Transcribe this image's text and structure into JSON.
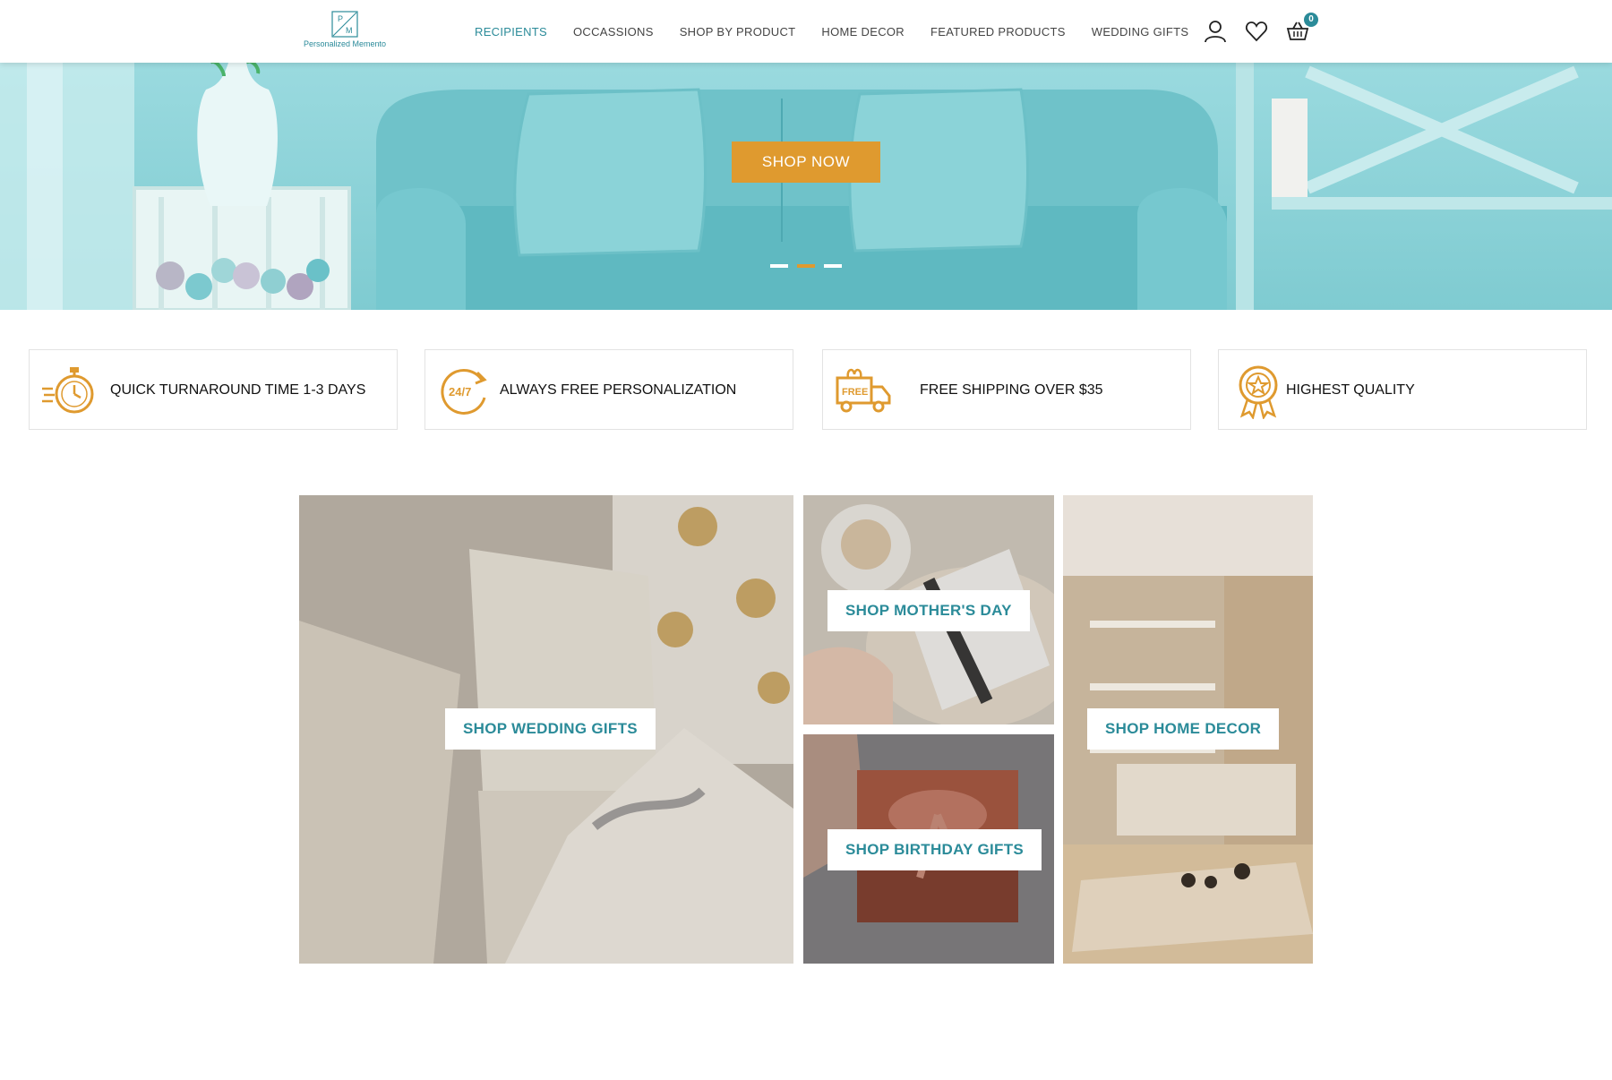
{
  "header": {
    "logo": {
      "monogram": "PM",
      "text": "Personalized Memento"
    },
    "nav": [
      {
        "label": "RECIPIENTS",
        "active": true
      },
      {
        "label": "OCCASSIONS",
        "active": false
      },
      {
        "label": "SHOP BY PRODUCT",
        "active": false
      },
      {
        "label": "HOME DECOR",
        "active": false
      },
      {
        "label": "FEATURED PRODUCTS",
        "active": false
      },
      {
        "label": "WEDDING GIFTS",
        "active": false
      }
    ],
    "icons": [
      "user-icon",
      "heart-icon",
      "basket-icon"
    ],
    "cart_count": "0"
  },
  "hero": {
    "cta_label": "SHOP NOW",
    "slides": 3,
    "active_slide": 2
  },
  "features": [
    {
      "icon": "stopwatch-icon",
      "text": "QUICK TURNAROUND TIME 1-3 DAYS"
    },
    {
      "icon": "24-7-icon",
      "icon_text": "24/7",
      "text": "ALWAYS FREE PERSONALIZATION"
    },
    {
      "icon": "free-truck-icon",
      "icon_text": "FREE",
      "text": "FREE SHIPPING OVER $35"
    },
    {
      "icon": "award-badge-icon",
      "text": "HIGHEST QUALITY"
    }
  ],
  "tiles": {
    "wedding": "SHOP WEDDING GIFTS",
    "mothers_day": "SHOP MOTHER'S DAY",
    "birthday": "SHOP BIRTHDAY GIFTS",
    "home_decor": "SHOP HOME DECOR"
  },
  "colors": {
    "accent_teal": "#2b8b99",
    "accent_orange": "#df9a2f",
    "hero_bg": "#8ed4d9"
  }
}
